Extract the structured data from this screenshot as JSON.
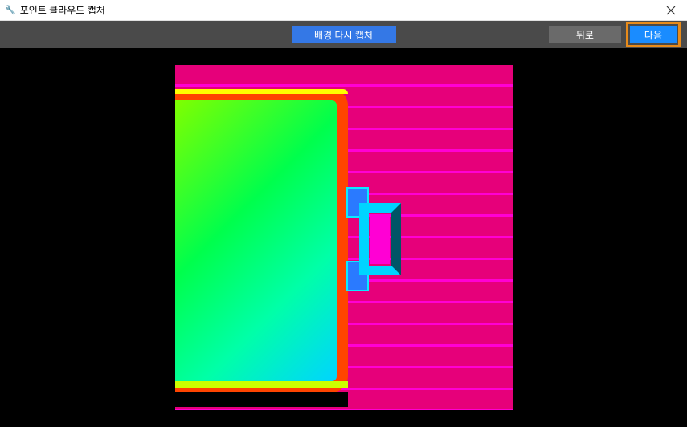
{
  "titlebar": {
    "icon": "🔧",
    "title": "포인트 클라우드 캡처"
  },
  "toolbar": {
    "recapture_label": "배경 다시 캡처",
    "back_label": "뒤로",
    "next_label": "다음"
  },
  "highlight": {
    "target": "next-button",
    "color": "#e88b1a"
  }
}
